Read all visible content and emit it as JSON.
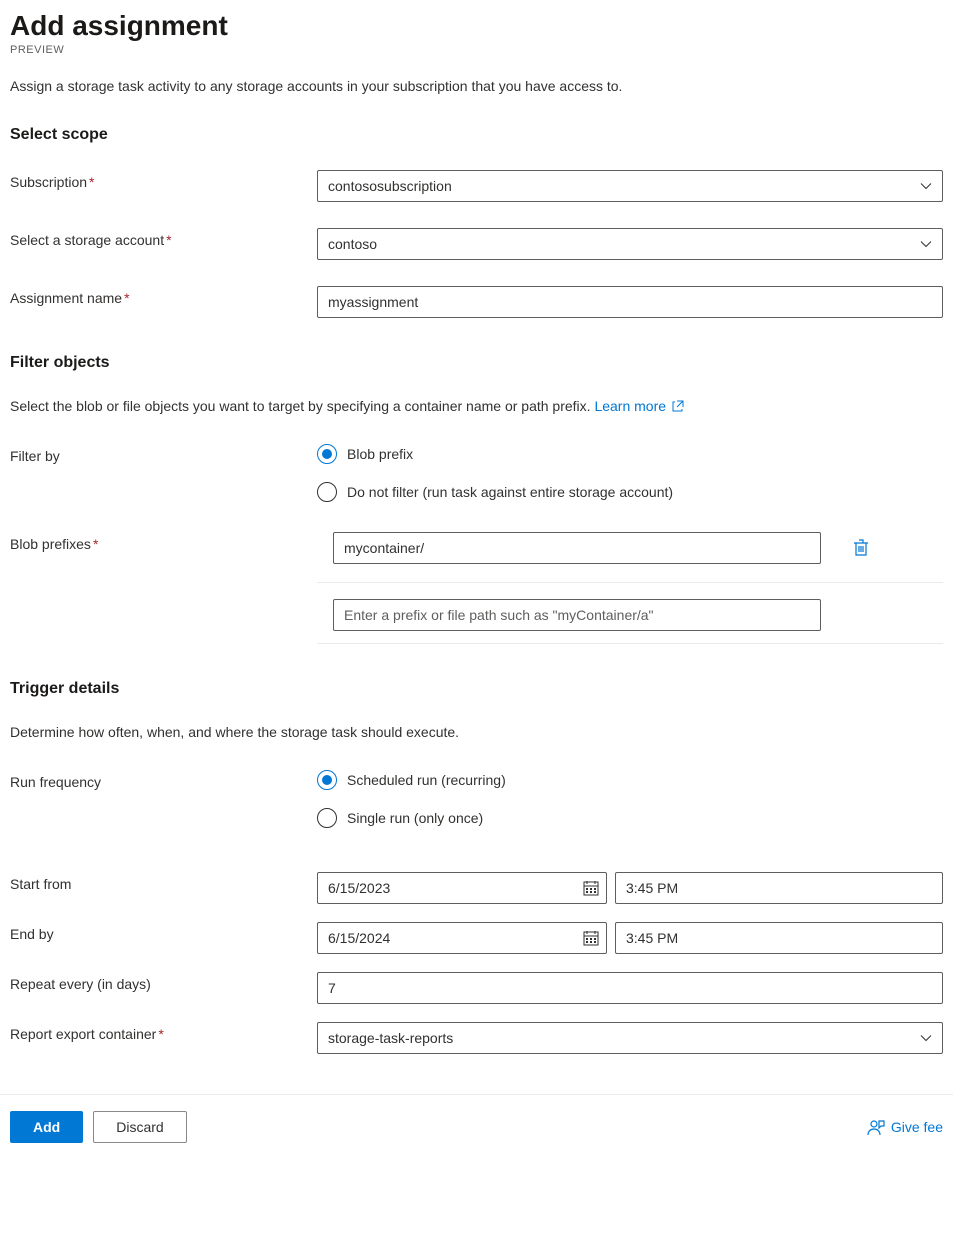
{
  "header": {
    "title": "Add assignment",
    "preview": "PREVIEW",
    "intro": "Assign a storage task activity to any storage accounts in your subscription that you have access to."
  },
  "scope": {
    "heading": "Select scope",
    "subscription_label": "Subscription",
    "subscription_value": "contososubscription",
    "storage_account_label": "Select a storage account",
    "storage_account_value": "contoso",
    "assignment_name_label": "Assignment name",
    "assignment_name_value": "myassignment"
  },
  "filter": {
    "heading": "Filter objects",
    "desc": "Select the blob or file objects you want to target by specifying a container name or path prefix.",
    "learn_more": "Learn more",
    "filter_by_label": "Filter by",
    "option_blob_prefix": "Blob prefix",
    "option_no_filter": "Do not filter (run task against entire storage account)",
    "blob_prefixes_label": "Blob prefixes",
    "prefixes": [
      "mycontainer/"
    ],
    "prefix_placeholder": "Enter a prefix or file path such as \"myContainer/a\""
  },
  "trigger": {
    "heading": "Trigger details",
    "desc": "Determine how often, when, and where the storage task should execute.",
    "run_frequency_label": "Run frequency",
    "option_scheduled": "Scheduled run (recurring)",
    "option_single": "Single run (only once)",
    "start_from_label": "Start from",
    "start_date": "6/15/2023",
    "start_time": "3:45 PM",
    "end_by_label": "End by",
    "end_date": "6/15/2024",
    "end_time": "3:45 PM",
    "repeat_label": "Repeat every (in days)",
    "repeat_value": "7",
    "report_container_label": "Report export container",
    "report_container_value": "storage-task-reports"
  },
  "footer": {
    "add": "Add",
    "discard": "Discard",
    "feedback": "Give fee"
  }
}
